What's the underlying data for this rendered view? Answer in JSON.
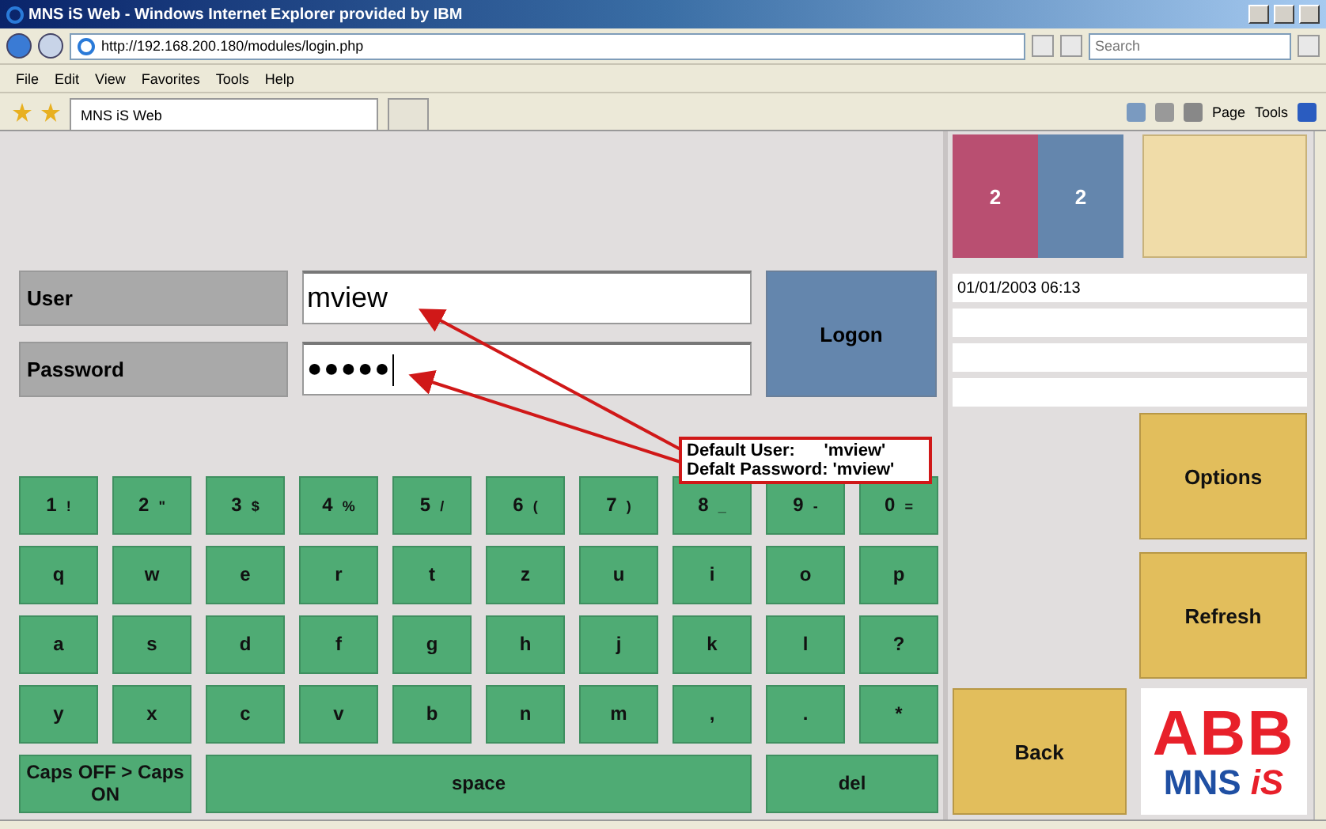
{
  "window": {
    "title": "MNS iS Web - Windows Internet Explorer provided by IBM"
  },
  "address_bar": {
    "url": "http://192.168.200.180/modules/login.php",
    "search_placeholder": "Search"
  },
  "menu": [
    "File",
    "Edit",
    "View",
    "Favorites",
    "Tools",
    "Help"
  ],
  "tabs": [
    {
      "label": "MNS iS Web",
      "selected": true
    }
  ],
  "command_bar": [
    "Page",
    "Tools"
  ],
  "login": {
    "user_label": "User",
    "user_value": "mview",
    "password_label": "Password",
    "password_value": "●●●●●",
    "logon": "Logon"
  },
  "callout": {
    "lines": [
      "Default User:      'mview'",
      "Defalt Password: 'mview'"
    ]
  },
  "keyboard": [
    [
      {
        "main": "1",
        "sub": "!"
      },
      {
        "main": "2",
        "sub": "\""
      },
      {
        "main": "3",
        "sub": "$"
      },
      {
        "main": "4",
        "sub": "%"
      },
      {
        "main": "5",
        "sub": "/"
      },
      {
        "main": "6",
        "sub": "("
      },
      {
        "main": "7",
        "sub": ")"
      },
      {
        "main": "8",
        "sub": "_"
      },
      {
        "main": "9",
        "sub": "-"
      },
      {
        "main": "0",
        "sub": "="
      }
    ],
    [
      {
        "main": "q"
      },
      {
        "main": "w"
      },
      {
        "main": "e"
      },
      {
        "main": "r"
      },
      {
        "main": "t"
      },
      {
        "main": "z"
      },
      {
        "main": "u"
      },
      {
        "main": "i"
      },
      {
        "main": "o"
      },
      {
        "main": "p"
      }
    ],
    [
      {
        "main": "a"
      },
      {
        "main": "s"
      },
      {
        "main": "d"
      },
      {
        "main": "f"
      },
      {
        "main": "g"
      },
      {
        "main": "h"
      },
      {
        "main": "j"
      },
      {
        "main": "k"
      },
      {
        "main": "l"
      },
      {
        "main": "?"
      }
    ],
    [
      {
        "main": "y"
      },
      {
        "main": "x"
      },
      {
        "main": "c"
      },
      {
        "main": "v"
      },
      {
        "main": "b"
      },
      {
        "main": "n"
      },
      {
        "main": "m"
      },
      {
        "main": ","
      },
      {
        "main": "."
      },
      {
        "main": "*"
      }
    ],
    [
      {
        "main": "Caps OFF > Caps ON",
        "kind": "caps"
      },
      {
        "main": "space",
        "kind": "space"
      },
      {
        "main": "del",
        "kind": "del"
      }
    ]
  ],
  "status_tiles": [
    {
      "value": "2",
      "color": "#b94f71"
    },
    {
      "value": "2",
      "color": "#6486ad"
    }
  ],
  "info_lines": [
    "01/01/2003 06:13"
  ],
  "buttons": {
    "options": "Options",
    "refresh": "Refresh",
    "back": "Back"
  },
  "logo": {
    "top": "ABB",
    "bottom_a": "MNS",
    "bottom_b": "iS"
  }
}
